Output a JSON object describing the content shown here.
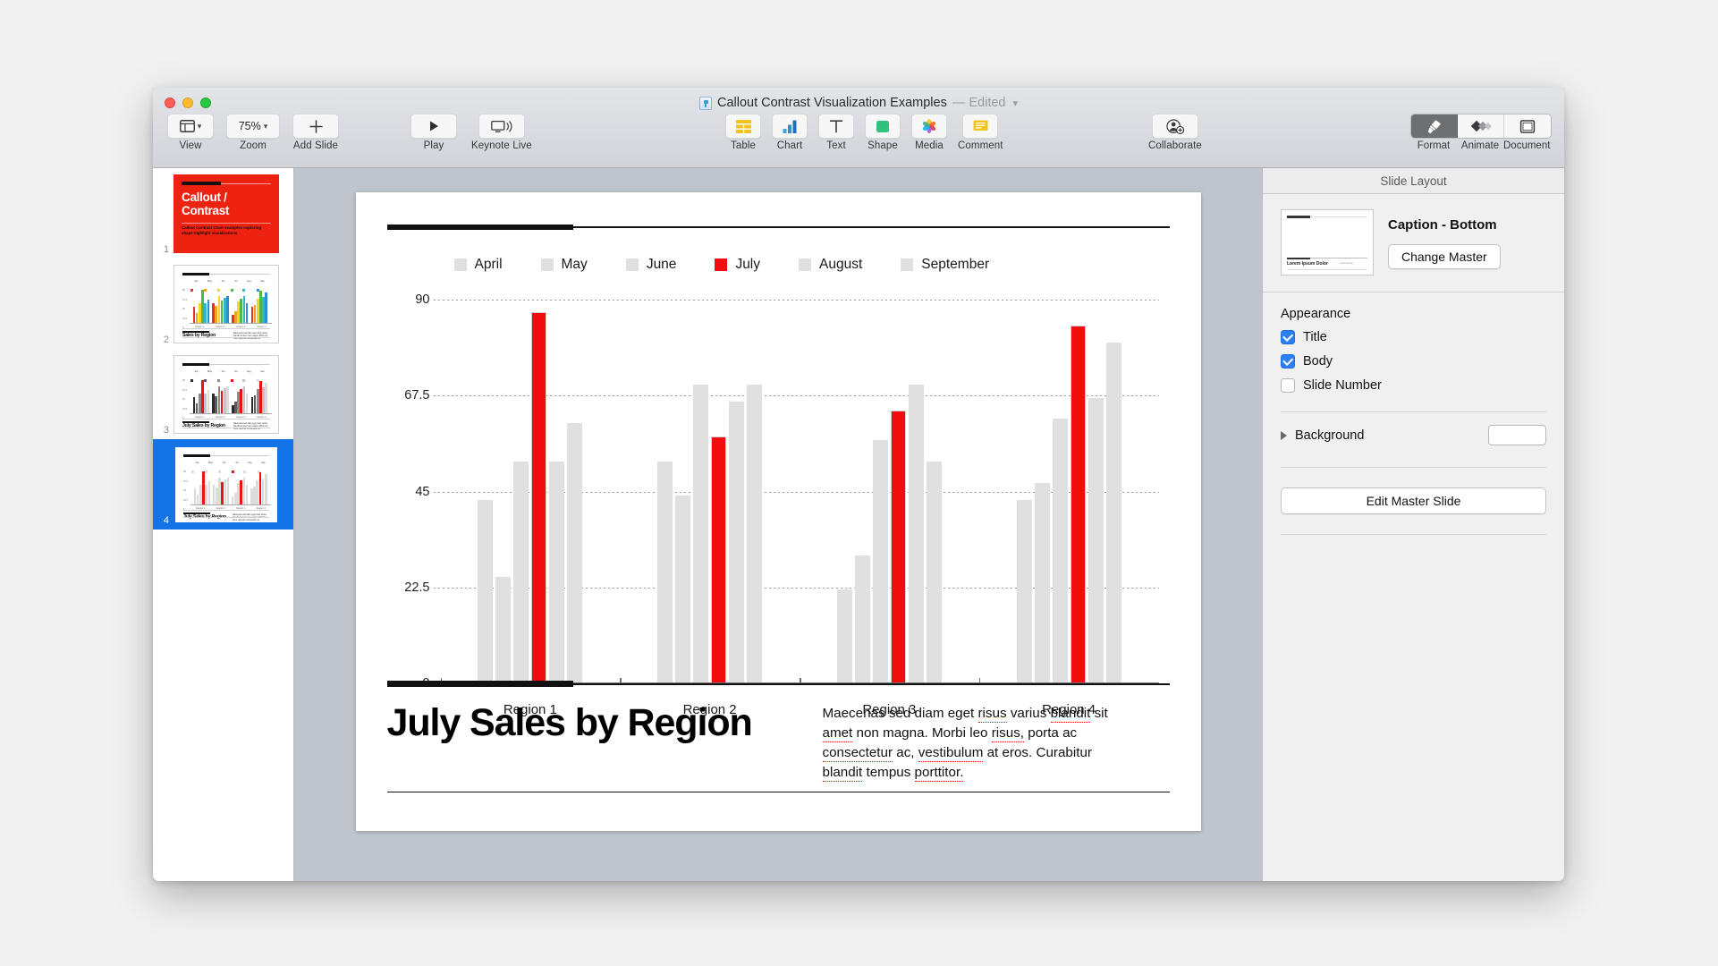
{
  "window": {
    "title": "Callout Contrast Visualization Examples",
    "edited_label": "— Edited",
    "doc_icon": "keynote-document-icon"
  },
  "toolbar": {
    "left": [
      {
        "name": "view",
        "label": "View",
        "icon": "view-layout-icon",
        "has_chevron": true
      },
      {
        "name": "zoom",
        "label": "Zoom",
        "value": "75%",
        "icon": "zoom-percent",
        "has_chevron": true
      },
      {
        "name": "add-slide",
        "label": "Add Slide",
        "icon": "plus-icon"
      }
    ],
    "play": [
      {
        "name": "play",
        "label": "Play",
        "icon": "play-triangle-icon"
      },
      {
        "name": "keynote-live",
        "label": "Keynote Live",
        "icon": "display-broadcast-icon"
      }
    ],
    "insert": [
      {
        "name": "table",
        "label": "Table",
        "icon": "table-grid-icon"
      },
      {
        "name": "chart",
        "label": "Chart",
        "icon": "bar-chart-icon"
      },
      {
        "name": "text",
        "label": "Text",
        "icon": "text-t-icon"
      },
      {
        "name": "shape",
        "label": "Shape",
        "icon": "square-shape-icon"
      },
      {
        "name": "media",
        "label": "Media",
        "icon": "photos-flower-icon"
      },
      {
        "name": "comment",
        "label": "Comment",
        "icon": "comment-lines-icon"
      }
    ],
    "collaborate": {
      "label": "Collaborate",
      "icon": "person-add-icon"
    },
    "inspector_tabs": [
      {
        "label": "Format",
        "icon": "paintbrush-icon",
        "active": true
      },
      {
        "label": "Animate",
        "icon": "diamonds-icon",
        "active": false
      },
      {
        "label": "Document",
        "icon": "document-frame-icon",
        "active": false
      }
    ]
  },
  "navigator": {
    "slides": [
      {
        "number": "1",
        "selected": false,
        "type": "title",
        "title_line1": "Callout /",
        "title_line2": "Contrast",
        "subtitle": "Callout Contrast Chart examples exploring shape highlight visualizations"
      },
      {
        "number": "2",
        "selected": false,
        "type": "chart",
        "caption": "Sales by Region",
        "palette": [
          "#e8322a",
          "#f4a020",
          "#f7d426",
          "#4cb944",
          "#34b6c9",
          "#2f8fd6"
        ],
        "body": "Maecenas sed diam eget risus varius blandit sit amet non magna. Morbi leo risus, porta ac consectetur ac."
      },
      {
        "number": "3",
        "selected": false,
        "type": "chart",
        "caption": "July Sales by Region",
        "palette": [
          "#2c2c2c",
          "#5c5c5c",
          "#8a8a8a",
          "#ee1111",
          "#c4c4c4",
          "#dcdcdc"
        ],
        "body": "Maecenas sed diam eget risus varius blandit sit amet non magna. Morbi leo risus, porta ac consectetur ac."
      },
      {
        "number": "4",
        "selected": true,
        "type": "chart",
        "caption": "July Sales by Region",
        "palette": [
          "#dcdcdc",
          "#dcdcdc",
          "#dcdcdc",
          "#ee1111",
          "#dcdcdc",
          "#dcdcdc"
        ],
        "body": "Maecenas sed diam eget risus varius blandit sit amet non magna. Morbi leo risus, porta ac consectetur ac."
      }
    ]
  },
  "slide": {
    "title": "July Sales by Region",
    "body_text": "Maecenas sed diam eget risus varius blandit sit amet non magna. Morbi leo risus, porta ac consectetur ac, vestibulum at eros. Curabitur blandit tempus porttitor.",
    "misspelled": [
      "risus",
      "blandit",
      "amet",
      "risus",
      "consectetur",
      "vestibulum",
      "blandit",
      "porttitor"
    ]
  },
  "chart_data": {
    "type": "bar",
    "title": "July Sales by Region",
    "xlabel": "",
    "ylabel": "",
    "ylim": [
      0,
      90
    ],
    "yticks": [
      "0",
      "22.5",
      "45",
      "67.5",
      "90"
    ],
    "ytick_values": [
      0,
      22.5,
      45,
      67.5,
      90
    ],
    "grid": true,
    "legend_position": "top",
    "highlight_series": "July",
    "highlight_color": "#f20d0d",
    "default_color": "#e0e0e0",
    "categories": [
      "Region 1",
      "Region 2",
      "Region 3",
      "Region 4"
    ],
    "series": [
      {
        "name": "April",
        "color": "#e0e0e0",
        "values": [
          43,
          52,
          22,
          43
        ]
      },
      {
        "name": "May",
        "color": "#e0e0e0",
        "values": [
          25,
          44,
          30,
          47
        ]
      },
      {
        "name": "June",
        "color": "#e0e0e0",
        "values": [
          52,
          70,
          57,
          62
        ]
      },
      {
        "name": "July",
        "color": "#f20d0d",
        "values": [
          87,
          58,
          64,
          84
        ]
      },
      {
        "name": "August",
        "color": "#e0e0e0",
        "values": [
          52,
          66,
          70,
          67
        ]
      },
      {
        "name": "September",
        "color": "#e0e0e0",
        "values": [
          61,
          70,
          52,
          80
        ]
      }
    ]
  },
  "inspector": {
    "header": "Slide Layout",
    "master_name": "Caption - Bottom",
    "master_thumb_text": "Lorem Ipsum Dolor",
    "change_master_button": "Change Master",
    "appearance_title": "Appearance",
    "appearance_options": [
      {
        "label": "Title",
        "checked": true
      },
      {
        "label": "Body",
        "checked": true
      },
      {
        "label": "Slide Number",
        "checked": false
      }
    ],
    "background_label": "Background",
    "edit_master_button": "Edit Master Slide"
  }
}
